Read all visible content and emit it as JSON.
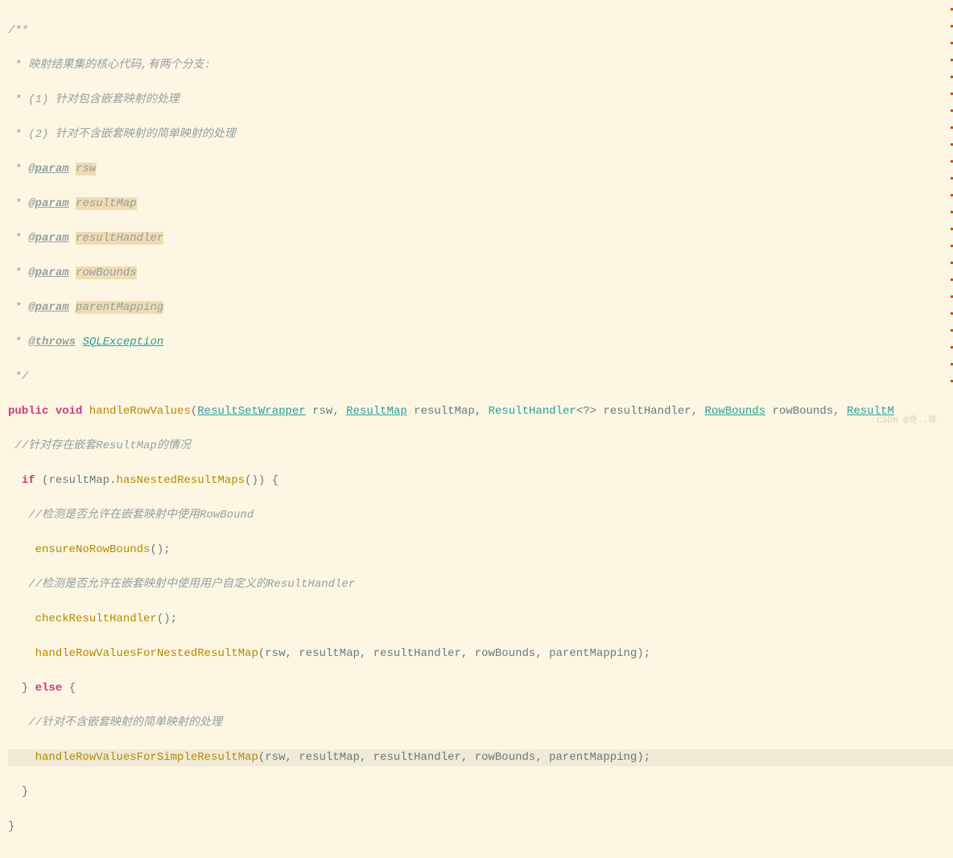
{
  "code": {
    "doc_start": "/**",
    "doc_line1": " * 映射结果集的核心代码,有两个分支:",
    "doc_line2": " * (1) 针对包含嵌套映射的处理",
    "doc_line3": " * (2) 针对不含嵌套映射的简单映射的处理",
    "doc_star": " * ",
    "tag_param": "@param",
    "tag_throws": "@throws",
    "param_rsw": "rsw",
    "param_resultMap": "resultMap",
    "param_resultHandler": "resultHandler",
    "param_rowBounds": "rowBounds",
    "param_parentMapping": "parentMapping",
    "exception_name": "SQLException",
    "doc_end": " */",
    "kw_public": "public",
    "kw_void": "void",
    "kw_if": "if",
    "kw_else": "else",
    "method_name": "handleRowValues",
    "type_ResultSetWrapper": "ResultSetWrapper",
    "type_ResultMap": "ResultMap",
    "type_ResultHandler": "ResultHandler",
    "type_RowBounds": "RowBounds",
    "type_ResultM": "ResultM",
    "var_rsw": "rsw",
    "var_resultMap": "resultMap",
    "var_resultHandler": "resultHandler",
    "var_rowBounds": "rowBounds",
    "generic": "<?>",
    "comment_nested": " //针对存在嵌套ResultMap的情况",
    "method_hasNestedResultMaps": "hasNestedResultMaps",
    "comment_rowbound": "   //检测是否允许在嵌套映射中使用RowBound",
    "method_ensureNoRowBounds": "ensureNoRowBounds",
    "comment_resulthandler": "   //检测是否允许在嵌套映射中使用用户自定义的ResultHandler",
    "method_checkResultHandler": "checkResultHandler",
    "method_handleRowValuesForNestedResultMap": "handleRowValuesForNestedResultMap",
    "comment_simple": "   //针对不含嵌套映射的简单映射的处理",
    "method_handleRowValuesForSimpleResultMap": "handleRowValuesForSimpleResultMap",
    "args_list": "(rsw, resultMap, resultHandler, rowBounds, parentMapping);",
    "open_paren": "(",
    "close_paren": ")",
    "open_brace": "{",
    "close_brace": "}",
    "dot": ".",
    "comma": ", ",
    "semi": ";",
    "empty_parens": "()",
    "space": " "
  },
  "watermark": "CSDN @奇..等"
}
